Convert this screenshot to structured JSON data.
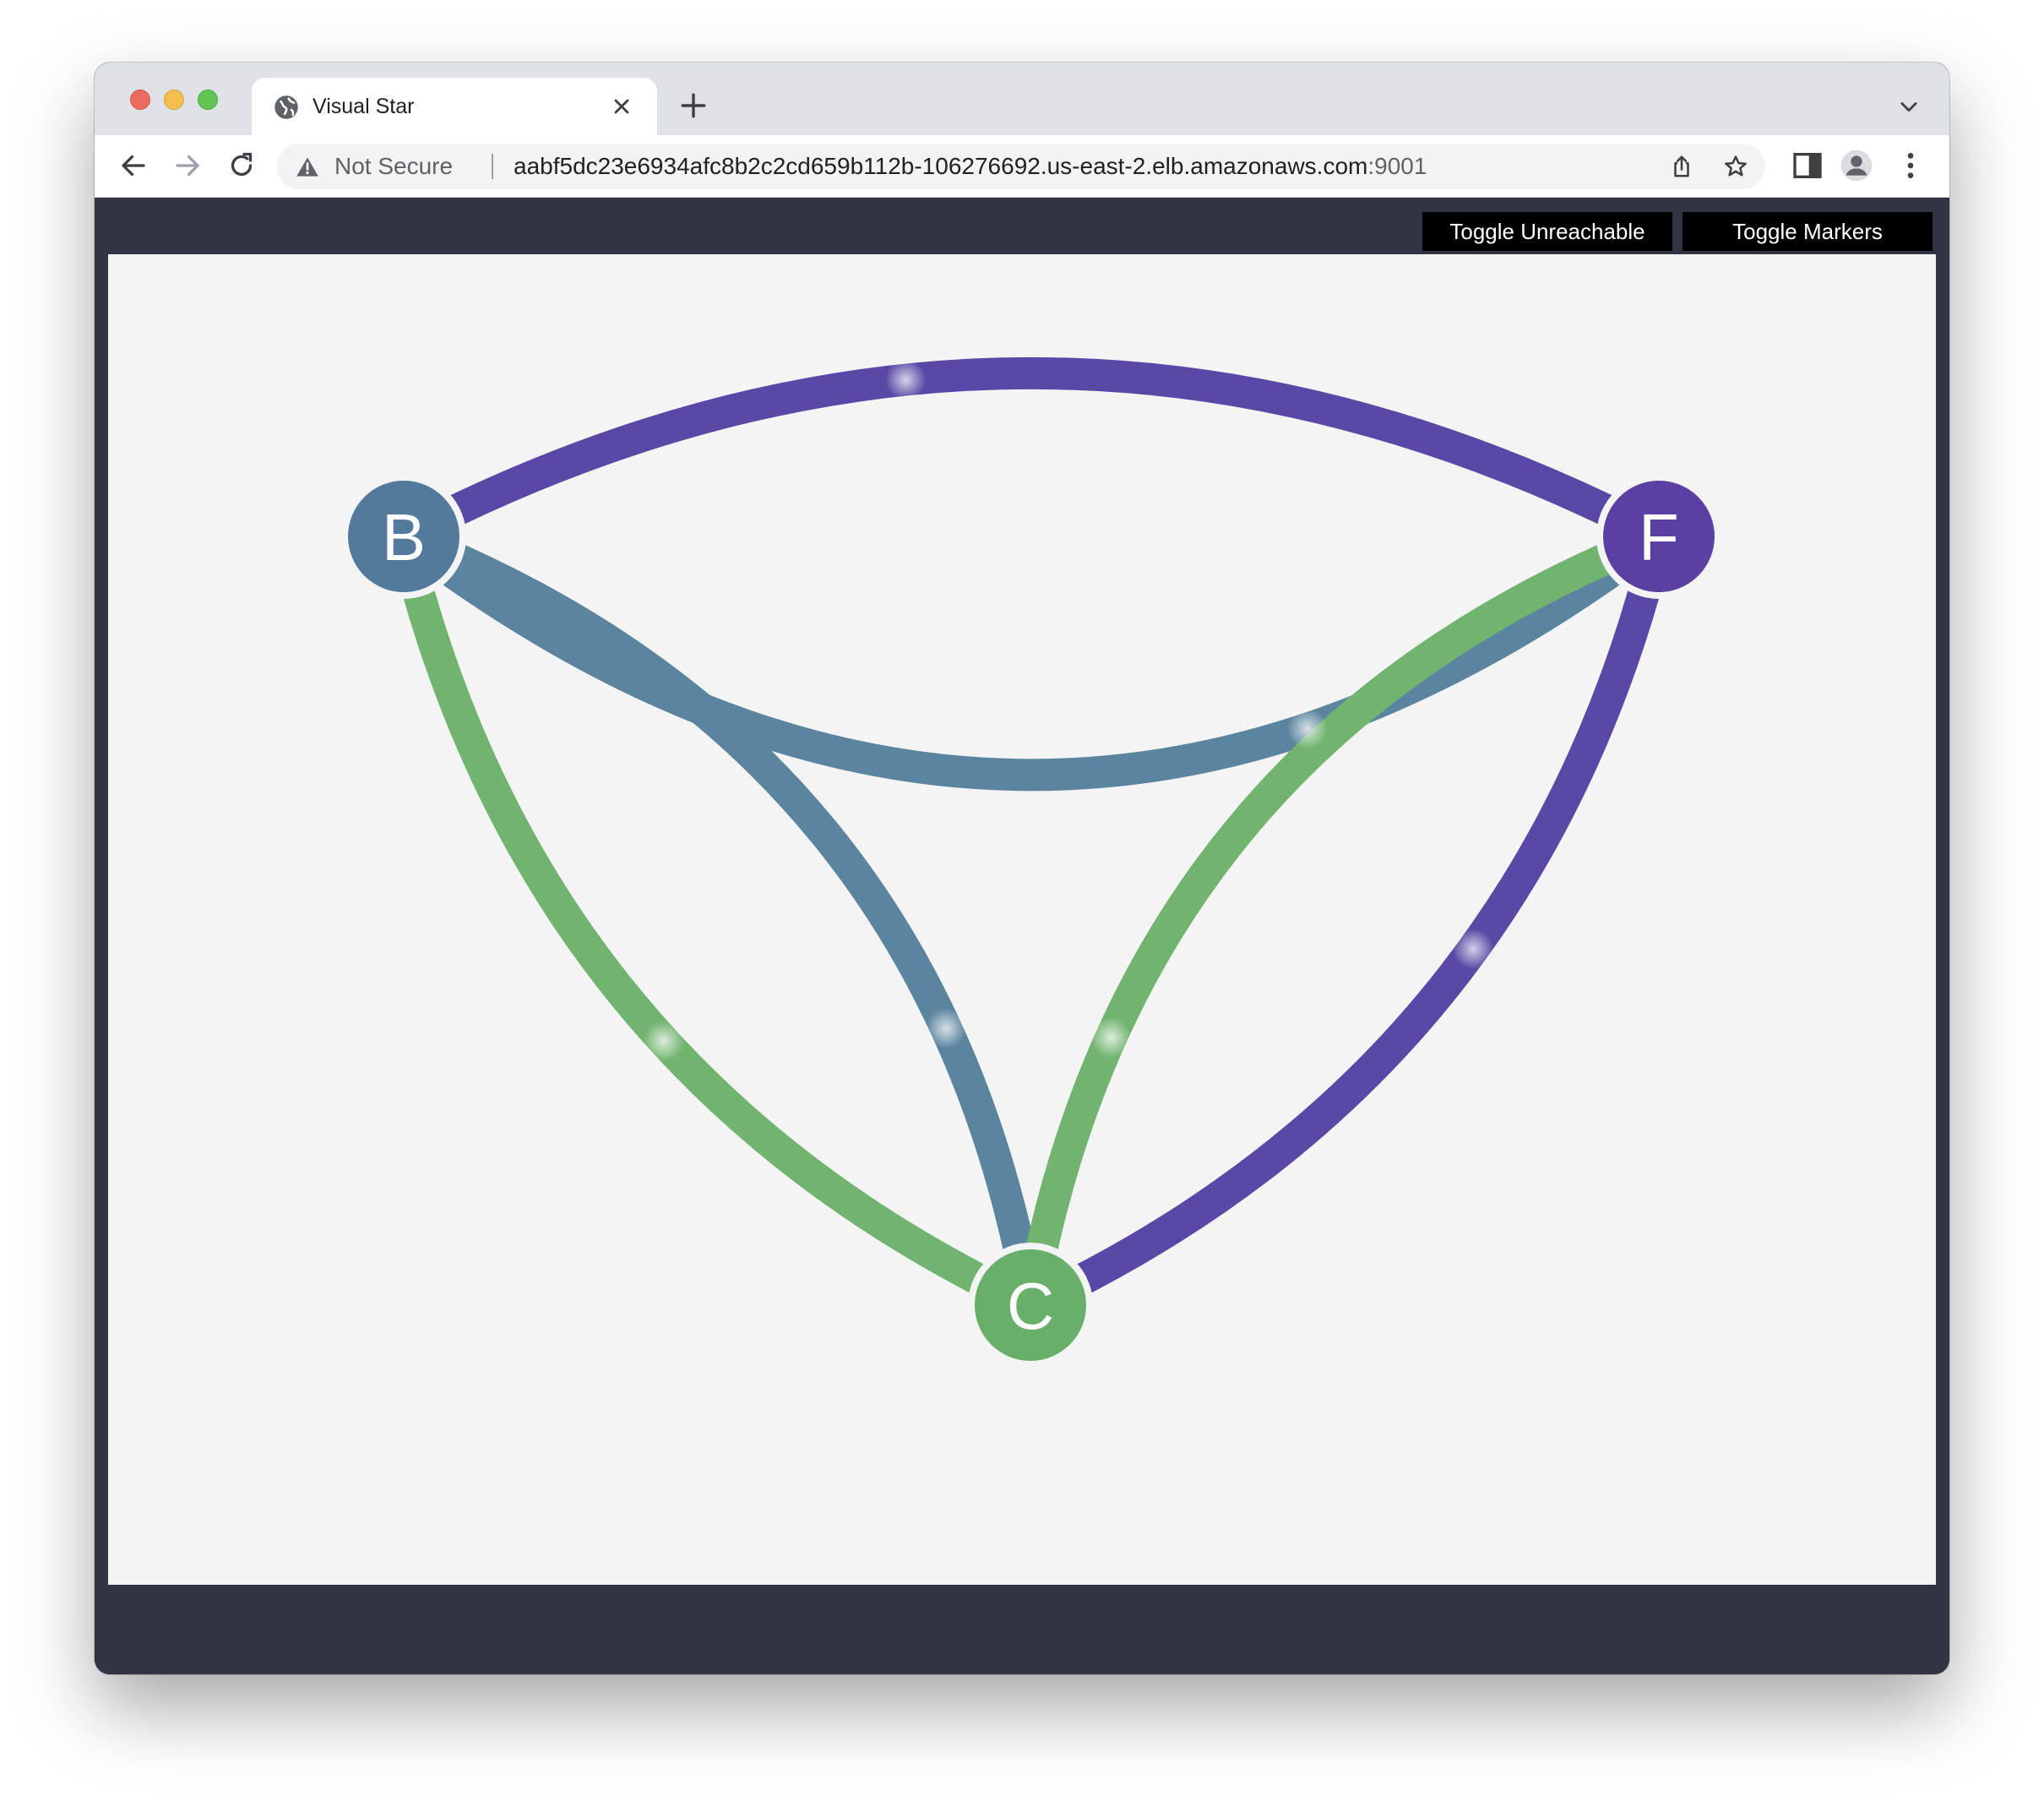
{
  "browser": {
    "tab": {
      "title": "Visual Star"
    },
    "address": {
      "security_label": "Not Secure",
      "url_host": "aabf5dc23e6934afc8b2c2cd659b112b-106276692.us-east-2.elb.amazonaws.com",
      "url_port": ":9001"
    }
  },
  "app": {
    "toggle_unreachable_label": "Toggle Unreachable",
    "toggle_markers_label": "Toggle Markers",
    "nodes": [
      {
        "id": "B",
        "label": "B",
        "color": "#537a9c"
      },
      {
        "id": "F",
        "label": "F",
        "color": "#5b3fa3"
      },
      {
        "id": "C",
        "label": "C",
        "color": "#68b069"
      }
    ],
    "edges": [
      {
        "from": "B",
        "to": "F",
        "color": "#5b48a6"
      },
      {
        "from": "F",
        "to": "B",
        "color": "#5b849f"
      },
      {
        "from": "B",
        "to": "C",
        "color": "#5b849f"
      },
      {
        "from": "C",
        "to": "B",
        "color": "#71b46f"
      },
      {
        "from": "F",
        "to": "C",
        "color": "#5b48a6"
      },
      {
        "from": "C",
        "to": "F",
        "color": "#71b46f"
      }
    ]
  }
}
